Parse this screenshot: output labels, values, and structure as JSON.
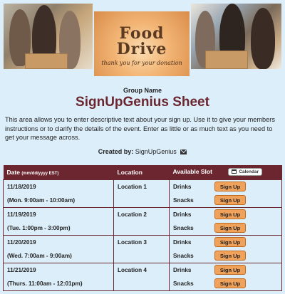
{
  "banner": {
    "logo_line1": "Food",
    "logo_line2": "Drive",
    "logo_tagline": "thank you for your donation"
  },
  "header": {
    "group_name": "Group Name",
    "title": "SignUpGenius Sheet",
    "description": "This area allows you to enter descriptive text about your sign up. Use it to give your members instructions or to clarify the details of the event. Enter as little or as much text as you need to get your message across.",
    "created_by_label": "Created by:",
    "created_by_name": "SignUpGenius"
  },
  "table": {
    "col_date": "Date",
    "col_date_format": "(mm/dd/yyyy EST)",
    "col_location": "Location",
    "col_slot": "Available Slot",
    "calendar_label": "Calendar",
    "signup_label": "Sign Up",
    "rows": [
      {
        "date": "11/18/2019",
        "time": "(Mon. 9:00am - 10:00am)",
        "location": "Location 1",
        "slots": [
          "Drinks",
          "Snacks"
        ]
      },
      {
        "date": "11/19/2019",
        "time": "(Tue. 1:00pm - 3:00pm)",
        "location": "Location 2",
        "slots": [
          "Drinks",
          "Snacks"
        ]
      },
      {
        "date": "11/20/2019",
        "time": "(Wed. 7:00am - 9:00am)",
        "location": "Location 3",
        "slots": [
          "Drinks",
          "Snacks"
        ]
      },
      {
        "date": "11/21/2019",
        "time": "(Thurs. 11:00am - 12:01pm)",
        "location": "Location 4",
        "slots": [
          "Drinks",
          "Snacks"
        ]
      }
    ]
  },
  "colors": {
    "page_bg": "#dceefa",
    "accent": "#6b2630",
    "button": "#f0a15a"
  }
}
